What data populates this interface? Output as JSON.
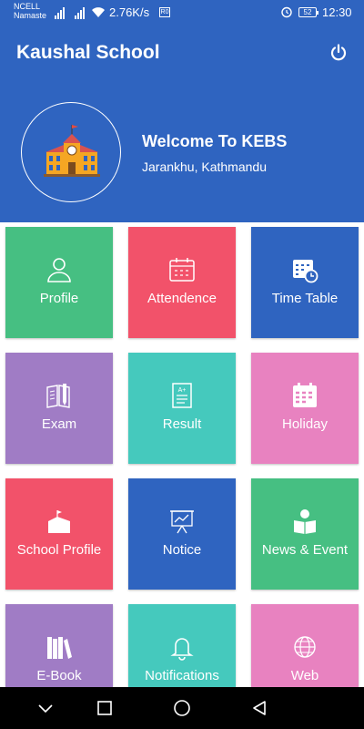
{
  "status_bar": {
    "carrier_line1": "NCELL",
    "carrier_line2": "Namaste",
    "net_speed": "2.76K/s",
    "nfc": "R0",
    "battery": "52",
    "time": "12:30"
  },
  "app_bar": {
    "title": "Kaushal School",
    "power_icon": "power-icon"
  },
  "header": {
    "logo_icon": "school-building-icon",
    "welcome": "Welcome To KEBS",
    "address": "Jarankhu, Kathmandu"
  },
  "colors": {
    "primary": "#2f64c0",
    "green": "#46bf82",
    "red": "#f2526a",
    "blue": "#2f64c0",
    "purple": "#a07cc5",
    "teal": "#45c9bd",
    "pink": "#e882c0"
  },
  "tiles": [
    {
      "label": "Profile",
      "icon": "user-icon",
      "color": "#46bf82"
    },
    {
      "label": "Attendence",
      "icon": "calendar-icon",
      "color": "#f2526a"
    },
    {
      "label": "Time Table",
      "icon": "calendar-clock-icon",
      "color": "#2f64c0"
    },
    {
      "label": "Exam",
      "icon": "book-pencil-icon",
      "color": "#a07cc5"
    },
    {
      "label": "Result",
      "icon": "report-card-icon",
      "color": "#45c9bd"
    },
    {
      "label": "Holiday",
      "icon": "calendar-grid-icon",
      "color": "#e882c0"
    },
    {
      "label": "School Profile",
      "icon": "school-flag-icon",
      "color": "#f2526a"
    },
    {
      "label": "Notice",
      "icon": "presentation-board-icon",
      "color": "#2f64c0"
    },
    {
      "label": "News & Event",
      "icon": "newspaper-reader-icon",
      "color": "#46bf82"
    },
    {
      "label": "E-Book",
      "icon": "books-icon",
      "color": "#a07cc5"
    },
    {
      "label": "Notifications",
      "icon": "bell-icon",
      "color": "#45c9bd"
    },
    {
      "label": "Web",
      "icon": "globe-icon",
      "color": "#e882c0"
    }
  ],
  "nav_bar": {
    "items": [
      "collapse-down-icon",
      "recent-apps-icon",
      "home-icon",
      "back-icon"
    ]
  }
}
